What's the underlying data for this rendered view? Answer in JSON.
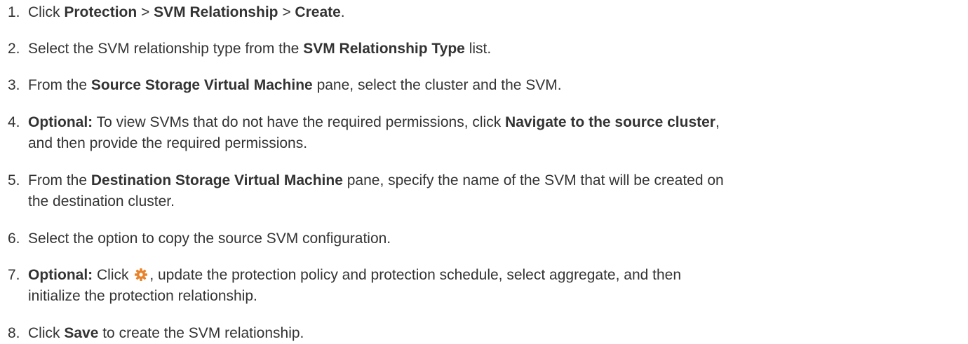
{
  "steps": [
    {
      "num": "1.",
      "parts": [
        {
          "t": "Click "
        },
        {
          "b": "Protection"
        },
        {
          "t": " > "
        },
        {
          "b": "SVM Relationship"
        },
        {
          "t": " > "
        },
        {
          "b": "Create"
        },
        {
          "t": "."
        }
      ]
    },
    {
      "num": "2.",
      "parts": [
        {
          "t": "Select the SVM relationship type from the "
        },
        {
          "b": "SVM Relationship Type"
        },
        {
          "t": " list."
        }
      ]
    },
    {
      "num": "3.",
      "parts": [
        {
          "t": "From the "
        },
        {
          "b": "Source Storage Virtual Machine"
        },
        {
          "t": " pane, select the cluster and the SVM."
        }
      ]
    },
    {
      "num": "4.",
      "parts": [
        {
          "b": "Optional:"
        },
        {
          "t": " To view SVMs that do not have the required permissions, click "
        },
        {
          "b": "Navigate to the source cluster"
        },
        {
          "t": ","
        },
        {
          "br": true
        },
        {
          "t": "and then provide the required permissions."
        }
      ]
    },
    {
      "num": "5.",
      "parts": [
        {
          "t": "From the "
        },
        {
          "b": "Destination Storage Virtual Machine"
        },
        {
          "t": " pane, specify the name of the SVM that will be created on"
        },
        {
          "br": true
        },
        {
          "t": "the destination cluster."
        }
      ]
    },
    {
      "num": "6.",
      "parts": [
        {
          "t": "Select the option to copy the source SVM configuration."
        }
      ]
    },
    {
      "num": "7.",
      "parts": [
        {
          "b": "Optional:"
        },
        {
          "t": " Click "
        },
        {
          "icon": "gear-icon"
        },
        {
          "t": ", update the protection policy and protection schedule, select aggregate, and then"
        },
        {
          "br": true
        },
        {
          "t": "initialize the protection relationship."
        }
      ]
    },
    {
      "num": "8.",
      "parts": [
        {
          "t": "Click "
        },
        {
          "b": "Save"
        },
        {
          "t": " to create the SVM relationship."
        }
      ]
    }
  ],
  "colors": {
    "text": "#333333",
    "gear": "#e8832a"
  }
}
